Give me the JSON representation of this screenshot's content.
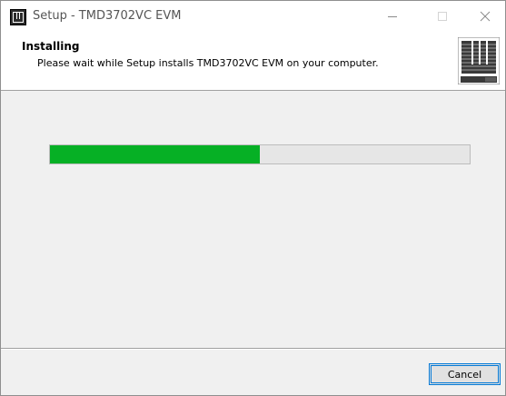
{
  "window": {
    "title": "Setup - TMD3702VC EVM"
  },
  "header": {
    "title": "Installing",
    "subtitle": "Please wait while Setup installs TMD3702VC EVM on your computer."
  },
  "progress": {
    "value": 0.5
  },
  "footer": {
    "cancel_label": "Cancel"
  },
  "icons": {
    "app": "ams-logo-icon",
    "minimize": "minimize-icon",
    "maximize": "maximize-icon",
    "close": "close-icon",
    "header_logo": "ams-logo-icon"
  },
  "colors": {
    "progress_fill": "#06b025",
    "accent": "#0078d7"
  }
}
